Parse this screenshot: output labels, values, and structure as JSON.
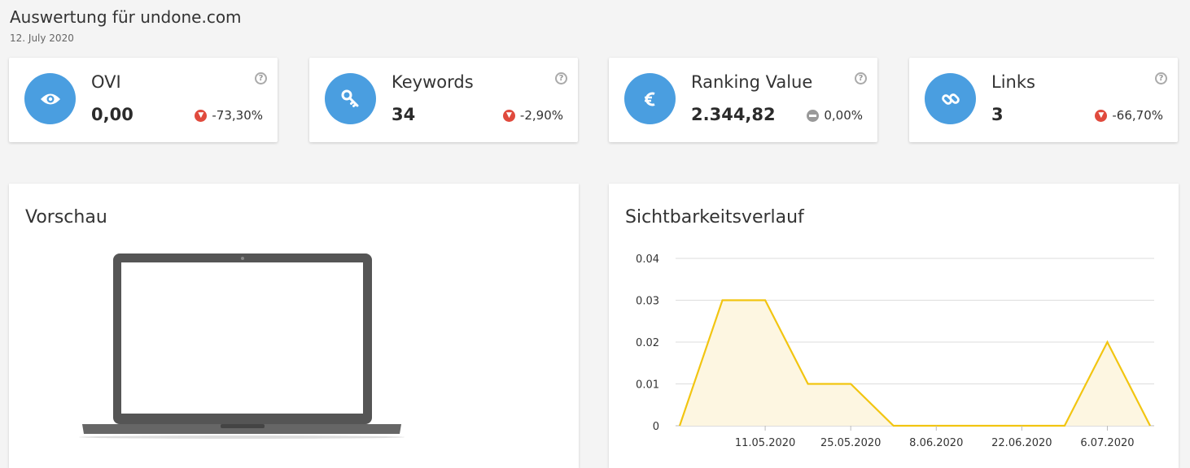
{
  "header": {
    "title": "Auswertung für undone.com",
    "date": "12. July 2020"
  },
  "kpis": [
    {
      "label": "OVI",
      "value": "0,00",
      "change": "-73,30%",
      "trend": "down",
      "icon": "eye-icon"
    },
    {
      "label": "Keywords",
      "value": "34",
      "change": "-2,90%",
      "trend": "down",
      "icon": "key-icon"
    },
    {
      "label": "Ranking Value",
      "value": "2.344,82",
      "change": "0,00%",
      "trend": "neutral",
      "icon": "euro-icon"
    },
    {
      "label": "Links",
      "value": "3",
      "change": "-66,70%",
      "trend": "down",
      "icon": "link-icon"
    }
  ],
  "help_glyph": "?",
  "preview": {
    "title": "Vorschau"
  },
  "visibility": {
    "title": "Sichtbarkeitsverlauf"
  },
  "colors": {
    "accent": "#4a9ee0",
    "down": "#e04a3d",
    "neutral": "#999999",
    "series_line": "#f2c511",
    "series_fill": "#fdf6e1"
  },
  "chart_data": {
    "type": "area",
    "title": "Sichtbarkeitsverlauf",
    "x": [
      "27.04.2020",
      "04.05.2020",
      "11.05.2020",
      "18.05.2020",
      "25.05.2020",
      "01.06.2020",
      "8.06.2020",
      "15.06.2020",
      "22.06.2020",
      "29.06.2020",
      "6.07.2020",
      "13.07.2020"
    ],
    "values": [
      0,
      0.03,
      0.03,
      0.01,
      0.01,
      0,
      0,
      0,
      0,
      0,
      0.02,
      0
    ],
    "xtick_labels": [
      "11.05.2020",
      "25.05.2020",
      "8.06.2020",
      "22.06.2020",
      "6.07.2020"
    ],
    "yticks": [
      "0",
      "0.01",
      "0.02",
      "0.03",
      "0.04"
    ],
    "ylim": [
      0,
      0.04
    ],
    "grid": true
  }
}
